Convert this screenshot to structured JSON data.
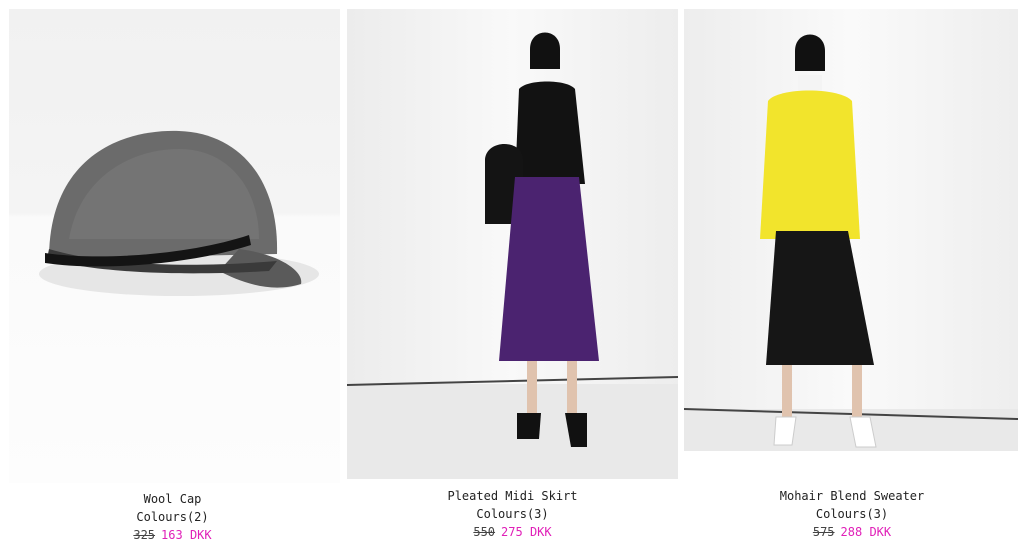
{
  "products": [
    {
      "name": "Wool Cap",
      "colours": "Colours(2)",
      "old_price": "325",
      "new_price": "163 DKK"
    },
    {
      "name": "Pleated Midi Skirt",
      "colours": "Colours(3)",
      "old_price": "550",
      "new_price": "275 DKK"
    },
    {
      "name": "Mohair Blend Sweater",
      "colours": "Colours(3)",
      "old_price": "575",
      "new_price": "288 DKK"
    }
  ],
  "colors": {
    "sale_price": "#e020b8"
  },
  "images": [
    {
      "icon": "wool-cap-image"
    },
    {
      "icon": "model-purple-skirt-image"
    },
    {
      "icon": "model-yellow-sweater-image"
    }
  ]
}
